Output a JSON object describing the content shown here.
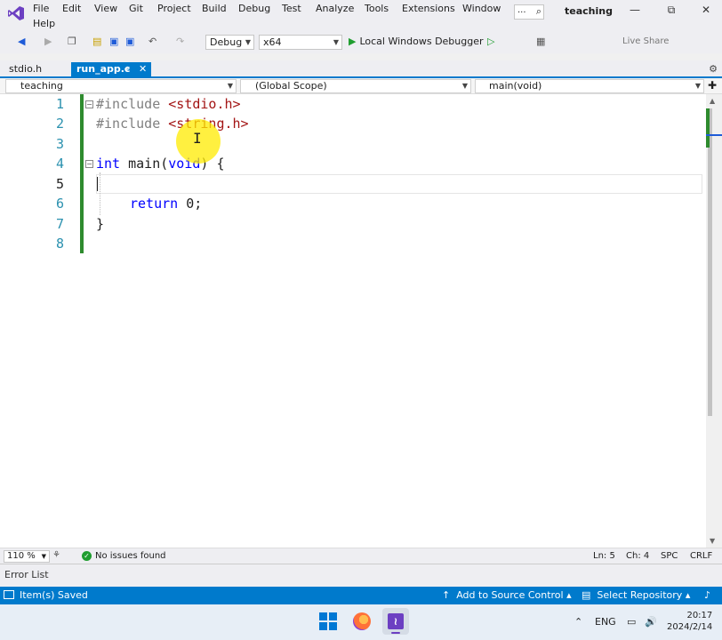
{
  "titlebar": {
    "menu": [
      "File",
      "Edit",
      "View",
      "Git",
      "Project",
      "Build",
      "Debug",
      "Test",
      "Analyze",
      "Tools",
      "Extensions",
      "Window",
      "Help"
    ],
    "search_label": "...",
    "solution_name": "teaching",
    "minimize": "—",
    "restore": "⧉",
    "close": "✕"
  },
  "toolbar": {
    "configuration": "Debug",
    "platform": "x64",
    "run_label": "Local Windows Debugger",
    "live_share": "Live Share"
  },
  "tabs": [
    {
      "label": "stdio.h",
      "active": false
    },
    {
      "label": "run_app.c",
      "active": true
    }
  ],
  "navbar": {
    "project": "teaching",
    "scope": "(Global Scope)",
    "member": "main(void)"
  },
  "editor": {
    "line_numbers": [
      "1",
      "2",
      "3",
      "4",
      "5",
      "6",
      "7",
      "8"
    ],
    "current_line": 5,
    "lines": {
      "l1_directive": "#include",
      "l1_header": " <stdio.h>",
      "l2_directive": "#include",
      "l2_header": " <string.h>",
      "l4_type": "int",
      "l4_rest": " main(",
      "l4_param": "void",
      "l4_end": ") {",
      "l6_kw": "return",
      "l6_rest": " 0;",
      "l7": "}"
    }
  },
  "editor_status": {
    "zoom": "110 %",
    "issues": "No issues found",
    "ln": "Ln: 5",
    "ch": "Ch: 4",
    "spc": "SPC",
    "crlf": "CRLF"
  },
  "errorlist": {
    "label": "Error List"
  },
  "statusbar": {
    "saved": "Item(s) Saved",
    "source_control": "Add to Source Control",
    "select_repo": "Select Repository"
  },
  "taskbar": {
    "lang": "ENG",
    "time": "20:17",
    "date": "2024/2/14"
  },
  "colors": {
    "accent": "#007acc",
    "keyword": "#0000ff",
    "include_string": "#a31515",
    "change_bar": "#2e8b2e"
  }
}
